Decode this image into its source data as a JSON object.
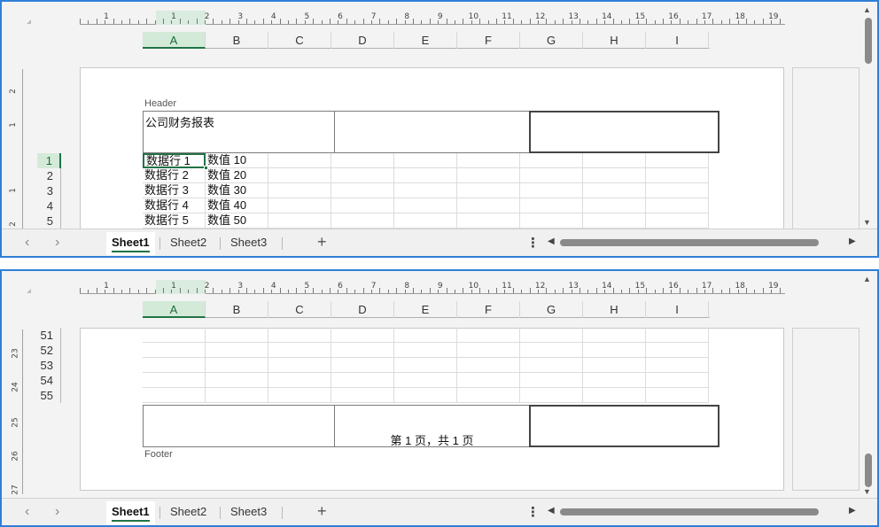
{
  "ruler": {
    "h_numbers": [
      "1",
      "1",
      "2",
      "3",
      "4",
      "5",
      "6",
      "7",
      "8",
      "9",
      "10",
      "11",
      "12",
      "13",
      "14",
      "15",
      "16",
      "17",
      "18",
      "19"
    ],
    "v_numbers_top": [
      "2",
      "1",
      "1",
      "2"
    ],
    "v_numbers_bottom": [
      "23",
      "24",
      "25",
      "26",
      "27"
    ]
  },
  "columns": [
    "A",
    "B",
    "C",
    "D",
    "E",
    "F",
    "G",
    "H",
    "I"
  ],
  "selected_column": "A",
  "header": {
    "label": "Header",
    "left_text": "公司财务报表",
    "center_text": "",
    "right_text": ""
  },
  "rows_top": [
    {
      "num": "1",
      "a": "数据行 1",
      "b": "数值 10"
    },
    {
      "num": "2",
      "a": "数据行 2",
      "b": "数值 20"
    },
    {
      "num": "3",
      "a": "数据行 3",
      "b": "数值 30"
    },
    {
      "num": "4",
      "a": "数据行 4",
      "b": "数值 40"
    },
    {
      "num": "5",
      "a": "数据行 5",
      "b": "数值 50"
    }
  ],
  "rows_bottom": [
    {
      "num": "51"
    },
    {
      "num": "52"
    },
    {
      "num": "53"
    },
    {
      "num": "54"
    },
    {
      "num": "55"
    }
  ],
  "footer": {
    "label": "Footer",
    "left_text": "",
    "center_text": "第 1 页，共 1 页",
    "right_text": ""
  },
  "sheet_tabs": [
    "Sheet1",
    "Sheet2",
    "Sheet3"
  ],
  "active_sheet": "Sheet1",
  "icons": {
    "prev": "‹",
    "next": "›",
    "add": "+",
    "more": "⋮",
    "scroll_left": "◀",
    "scroll_right": "▶",
    "scroll_up": "▲",
    "scroll_down": "▼"
  },
  "colors": {
    "accent": "#217346",
    "pane_border": "#2f7fd8",
    "selection_fill": "#d4ead9"
  }
}
